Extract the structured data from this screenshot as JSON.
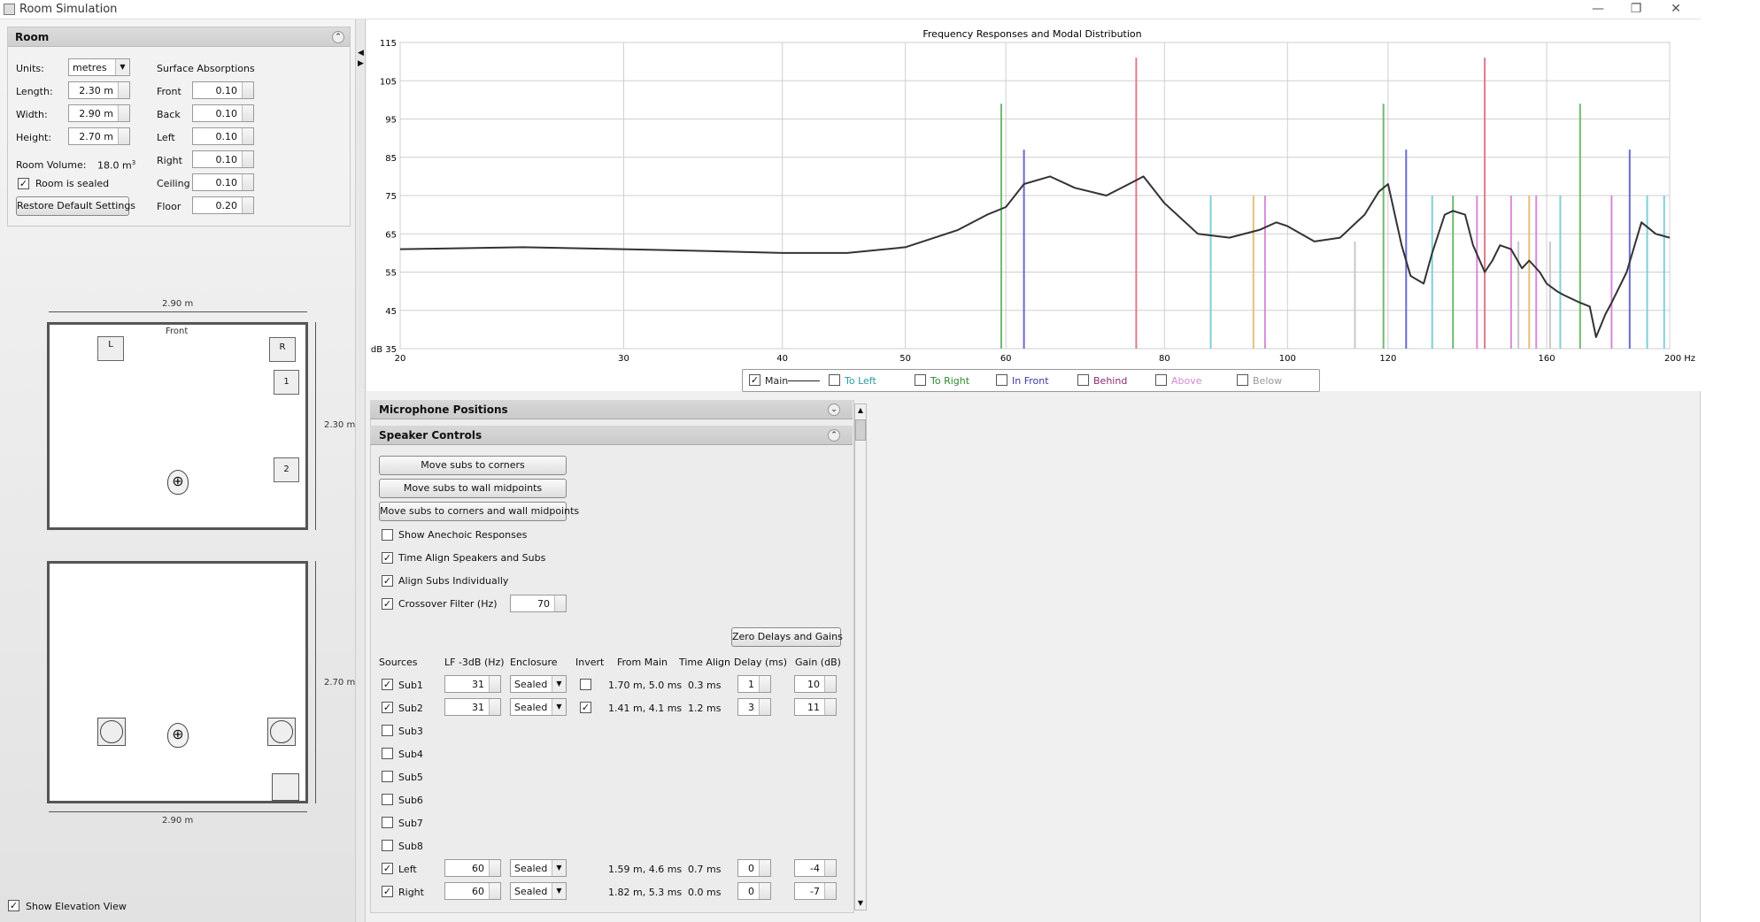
{
  "window": {
    "title": "Room Simulation",
    "minimize": "—",
    "restore": "❐",
    "close": "✕"
  },
  "room": {
    "title": "Room",
    "units_label": "Units:",
    "units_value": "metres",
    "length_label": "Length:",
    "length_value": "2.30 m",
    "width_label": "Width:",
    "width_value": "2.90 m",
    "height_label": "Height:",
    "height_value": "2.70 m",
    "volume_label": "Room Volume:",
    "volume_value": "18.0 m",
    "volume_sup": "3",
    "sealed_label": "Room is sealed",
    "restore_label": "Restore Default Settings",
    "absorptions_title": "Surface Absorptions",
    "absorptions": [
      {
        "label": "Front",
        "value": "0.10"
      },
      {
        "label": "Back",
        "value": "0.10"
      },
      {
        "label": "Left",
        "value": "0.10"
      },
      {
        "label": "Right",
        "value": "0.10"
      },
      {
        "label": "Ceiling",
        "value": "0.10"
      },
      {
        "label": "Floor",
        "value": "0.20"
      }
    ]
  },
  "plan": {
    "top_dim": "2.90 m",
    "side_dim": "2.30 m",
    "front_label": "Front",
    "speaker_left": "L",
    "speaker_right": "R",
    "sub1": "1",
    "sub2": "2"
  },
  "elevation": {
    "side_dim": "2.70 m",
    "bottom_dim": "2.90 m",
    "show_label": "Show Elevation View"
  },
  "chart_data": {
    "type": "line",
    "title": "Frequency Responses and Modal Distribution",
    "x_ticks": [
      "20",
      "30",
      "40",
      "50",
      "60",
      "80",
      "100",
      "120",
      "160",
      "200 Hz"
    ],
    "x_tick_values": [
      20,
      30,
      40,
      50,
      60,
      80,
      100,
      120,
      160,
      200
    ],
    "y_ticks": [
      "115",
      "105",
      "95",
      "85",
      "75",
      "65",
      "55",
      "45",
      "dB 35"
    ],
    "x_log": true,
    "xlim": [
      20,
      200
    ],
    "ylim": [
      35,
      115
    ],
    "grid": true,
    "series": [
      {
        "name": "Main",
        "color": "#333333",
        "x": [
          20,
          25,
          30,
          35,
          40,
          45,
          50,
          55,
          58,
          60,
          62,
          65,
          68,
          72,
          75,
          77,
          80,
          85,
          90,
          95,
          98,
          100,
          105,
          110,
          115,
          118,
          120,
          123,
          125,
          128,
          130,
          133,
          135,
          138,
          140,
          143,
          145,
          147,
          150,
          153,
          155,
          158,
          160,
          163,
          165,
          170,
          173,
          175,
          178,
          180,
          185,
          190,
          195,
          200
        ],
        "y": [
          61,
          61.5,
          61,
          60.5,
          60,
          60,
          61.5,
          66,
          70,
          72,
          78,
          80,
          77,
          75,
          78,
          80,
          73,
          65,
          64,
          66,
          68,
          67,
          63,
          64,
          70,
          76,
          78,
          62,
          54,
          52,
          60,
          70,
          71,
          70,
          62,
          55,
          58,
          62,
          61,
          56,
          58,
          55,
          52,
          50,
          49,
          47,
          46,
          38,
          44,
          47,
          55,
          68,
          65,
          64
        ]
      }
    ],
    "modes": [
      {
        "x": 59.5,
        "y": 99,
        "group": "To Right",
        "color": "#6fba6f"
      },
      {
        "x": 62,
        "y": 87,
        "group": "In Front",
        "color": "#6a6acd"
      },
      {
        "x": 76,
        "y": 111,
        "group": "Behind",
        "color": "#e07a8a"
      },
      {
        "x": 87,
        "y": 75,
        "group": "To Left",
        "color": "#7fd0d6"
      },
      {
        "x": 94,
        "y": 75,
        "group": "Above",
        "color": "#e6c07a"
      },
      {
        "x": 96,
        "y": 75,
        "group": "Above",
        "color": "#d88ad8"
      },
      {
        "x": 113,
        "y": 63,
        "group": "Below",
        "color": "#c8c8c8"
      },
      {
        "x": 119,
        "y": 99,
        "group": "To Right",
        "color": "#6fba6f"
      },
      {
        "x": 124,
        "y": 87,
        "group": "In Front",
        "color": "#6a6acd"
      },
      {
        "x": 130,
        "y": 75,
        "group": "To Left",
        "color": "#7fd0d6"
      },
      {
        "x": 135,
        "y": 75,
        "group": "To Right",
        "color": "#6fba6f"
      },
      {
        "x": 141,
        "y": 75,
        "group": "Above",
        "color": "#d88ad8"
      },
      {
        "x": 143,
        "y": 111,
        "group": "Behind",
        "color": "#e07a8a"
      },
      {
        "x": 150,
        "y": 75,
        "group": "Above",
        "color": "#d88ad8"
      },
      {
        "x": 152,
        "y": 63,
        "group": "Below",
        "color": "#c8c8c8"
      },
      {
        "x": 155,
        "y": 75,
        "group": "Above",
        "color": "#e6c07a"
      },
      {
        "x": 157,
        "y": 75,
        "group": "Above",
        "color": "#d88ad8"
      },
      {
        "x": 161,
        "y": 63,
        "group": "Below",
        "color": "#c8c8c8"
      },
      {
        "x": 164,
        "y": 75,
        "group": "To Left",
        "color": "#7fd0d6"
      },
      {
        "x": 170,
        "y": 99,
        "group": "To Right",
        "color": "#6fba6f"
      },
      {
        "x": 180,
        "y": 75,
        "group": "Above",
        "color": "#d88ad8"
      },
      {
        "x": 186,
        "y": 87,
        "group": "In Front",
        "color": "#6a6acd"
      },
      {
        "x": 192,
        "y": 75,
        "group": "To Left",
        "color": "#7fd0d6"
      },
      {
        "x": 198,
        "y": 75,
        "group": "To Left",
        "color": "#7fd0d6"
      }
    ]
  },
  "legend": {
    "items": [
      {
        "label": "Main",
        "checked": "✓",
        "color": "#222222"
      },
      {
        "label": "To Left",
        "checked": "",
        "color": "#2a9aa5"
      },
      {
        "label": "To Right",
        "checked": "",
        "color": "#2e8b2e"
      },
      {
        "label": "In Front",
        "checked": "",
        "color": "#3a3aa0"
      },
      {
        "label": "Behind",
        "checked": "",
        "color": "#8a2a6a"
      },
      {
        "label": "Above",
        "checked": "",
        "color": "#d08ad0"
      },
      {
        "label": "Below",
        "checked": "",
        "color": "#999999"
      }
    ]
  },
  "mic": {
    "title": "Microphone Positions"
  },
  "speaker": {
    "title": "Speaker Controls",
    "btn_corners": "Move subs to corners",
    "btn_midpoints": "Move subs to wall midpoints",
    "btn_both": "Move subs to corners and wall midpoints",
    "opt_anechoic": "Show Anechoic Responses",
    "opt_timealign": "Time Align Speakers and Subs",
    "opt_individual": "Align Subs Individually",
    "opt_crossover": "Crossover Filter (Hz)",
    "crossover_value": "70",
    "zero_btn": "Zero Delays and Gains",
    "headers": [
      "Sources",
      "LF -3dB (Hz)",
      "Enclosure",
      "Invert",
      "From Main",
      "Time Align",
      "Delay (ms)",
      "Gain (dB)"
    ],
    "rows": [
      {
        "name": "Sub1",
        "checked": "✓",
        "lf": "31",
        "enc": "Sealed",
        "invert": "",
        "from": "1.70 m, 5.0 ms",
        "ta": "0.3 ms",
        "delay": "1",
        "gain": "10"
      },
      {
        "name": "Sub2",
        "checked": "✓",
        "lf": "31",
        "enc": "Sealed",
        "invert": "✓",
        "from": "1.41 m, 4.1 ms",
        "ta": "1.2 ms",
        "delay": "3",
        "gain": "11"
      },
      {
        "name": "Sub3",
        "checked": ""
      },
      {
        "name": "Sub4",
        "checked": ""
      },
      {
        "name": "Sub5",
        "checked": ""
      },
      {
        "name": "Sub6",
        "checked": ""
      },
      {
        "name": "Sub7",
        "checked": ""
      },
      {
        "name": "Sub8",
        "checked": ""
      },
      {
        "name": "Left",
        "checked": "✓",
        "lf": "60",
        "enc": "Sealed",
        "from": "1.59 m, 4.6 ms",
        "ta": "0.7 ms",
        "delay": "0",
        "gain": "-4"
      },
      {
        "name": "Right",
        "checked": "✓",
        "lf": "60",
        "enc": "Sealed",
        "from": "1.82 m, 5.3 ms",
        "ta": "0.0 ms",
        "delay": "0",
        "gain": "-7"
      }
    ]
  }
}
